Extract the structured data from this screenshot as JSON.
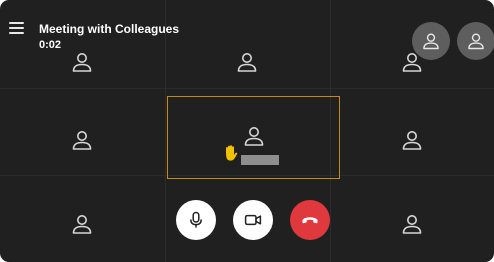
{
  "meeting": {
    "title": "Meeting with Colleagues",
    "elapsed": "0:02"
  },
  "grid": {
    "rows": 3,
    "columns": 3,
    "participant_icon": "person-icon",
    "active_tile": "center",
    "raised_hand_icon": "raised-hand-icon"
  },
  "top_right_avatars": [
    "person-icon",
    "person-icon"
  ],
  "controls": [
    {
      "name": "microphone",
      "icon": "microphone-icon"
    },
    {
      "name": "camera",
      "icon": "video-camera-icon"
    },
    {
      "name": "end-call",
      "icon": "hang-up-icon"
    }
  ],
  "colors": {
    "background": "#202020",
    "active_border": "#c58a12",
    "end_call": "#e0393d",
    "raised_hand": "#f2c200"
  }
}
